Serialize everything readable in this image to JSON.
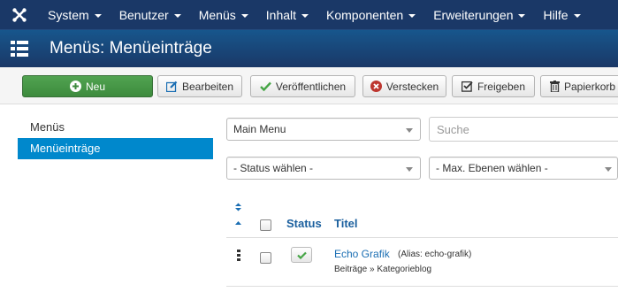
{
  "navbar": {
    "items": [
      {
        "label": "System"
      },
      {
        "label": "Benutzer"
      },
      {
        "label": "Menüs"
      },
      {
        "label": "Inhalt"
      },
      {
        "label": "Komponenten"
      },
      {
        "label": "Erweiterungen"
      },
      {
        "label": "Hilfe"
      }
    ]
  },
  "header": {
    "title": "Menüs: Menüeinträge",
    "icon": "list-icon"
  },
  "toolbar": {
    "new_label": "Neu",
    "edit_label": "Bearbeiten",
    "publish_label": "Veröffentlichen",
    "unpublish_label": "Verstecken",
    "checkin_label": "Freigeben",
    "trash_label": "Papierkorb"
  },
  "sidebar": {
    "items": [
      {
        "label": "Menüs",
        "active": false
      },
      {
        "label": "Menüeinträge",
        "active": true
      }
    ]
  },
  "filters": {
    "menu_select": "Main Menu",
    "search_placeholder": "Suche",
    "status_select": "- Status wählen -",
    "levels_select": "- Max. Ebenen wählen -"
  },
  "table": {
    "headers": {
      "status": "Status",
      "title": "Titel"
    },
    "rows": [
      {
        "title": "Echo Grafik",
        "alias": "(Alias: echo-grafik)",
        "sub": "Beiträge » Kategorieblog",
        "published": true
      }
    ]
  },
  "colors": {
    "navbar": "#1a3867",
    "header": "#17568c",
    "new_button": "#51a351",
    "active": "#0088cc",
    "link": "#1a6eb3"
  }
}
